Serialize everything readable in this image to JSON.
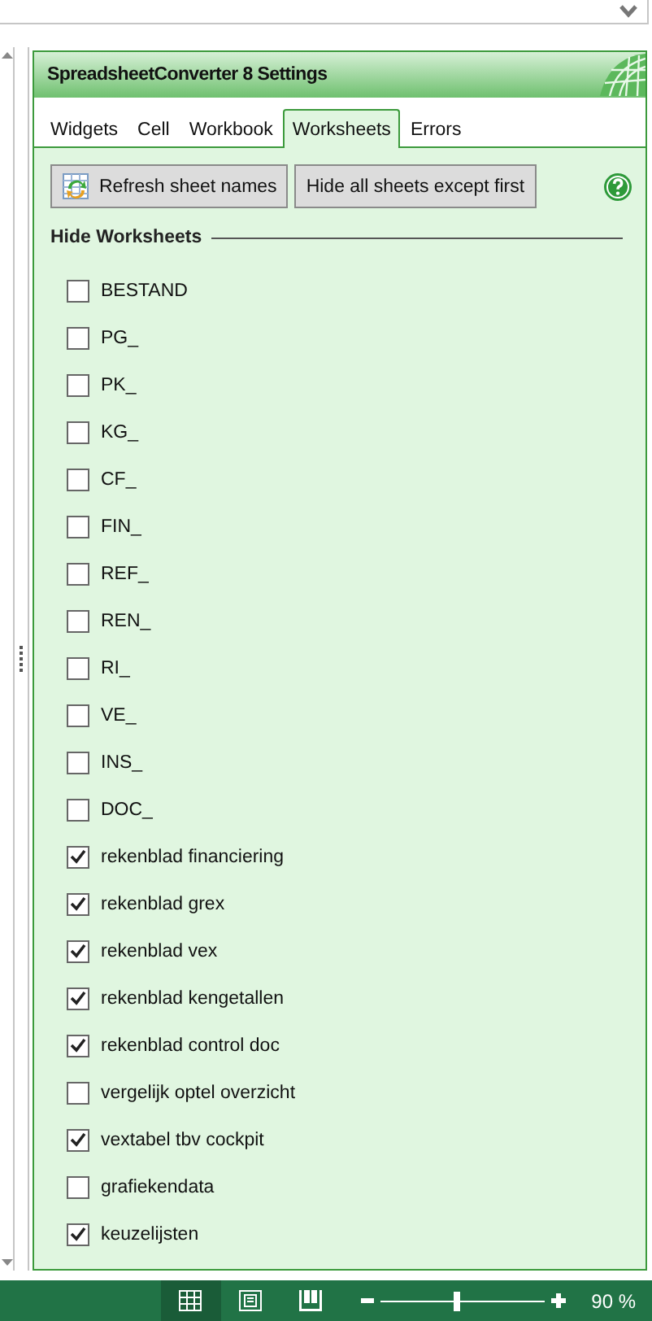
{
  "panel": {
    "title": "SpreadsheetConverter 8 Settings"
  },
  "tabs": [
    {
      "label": "Widgets",
      "selected": false
    },
    {
      "label": "Cell",
      "selected": false
    },
    {
      "label": "Workbook",
      "selected": false
    },
    {
      "label": "Worksheets",
      "selected": true
    },
    {
      "label": "Errors",
      "selected": false
    }
  ],
  "buttons": [
    "Refresh sheet names",
    "Hide all sheets except first"
  ],
  "section": {
    "title": "Hide Worksheets"
  },
  "worksheets": [
    {
      "label": "BESTAND",
      "checked": false
    },
    {
      "label": "PG_",
      "checked": false
    },
    {
      "label": "PK_",
      "checked": false
    },
    {
      "label": "KG_",
      "checked": false
    },
    {
      "label": "CF_",
      "checked": false
    },
    {
      "label": "FIN_",
      "checked": false
    },
    {
      "label": "REF_",
      "checked": false
    },
    {
      "label": "REN_",
      "checked": false
    },
    {
      "label": "RI_",
      "checked": false
    },
    {
      "label": "VE_",
      "checked": false
    },
    {
      "label": "INS_",
      "checked": false
    },
    {
      "label": "DOC_",
      "checked": false
    },
    {
      "label": "rekenblad financiering",
      "checked": true
    },
    {
      "label": "rekenblad grex",
      "checked": true
    },
    {
      "label": "rekenblad vex",
      "checked": true
    },
    {
      "label": "rekenblad kengetallen",
      "checked": true
    },
    {
      "label": "rekenblad control doc",
      "checked": true
    },
    {
      "label": "vergelijk optel overzicht",
      "checked": false
    },
    {
      "label": "vextabel tbv cockpit",
      "checked": true
    },
    {
      "label": "grafiekendata",
      "checked": false
    },
    {
      "label": "keuzelijsten",
      "checked": true
    }
  ],
  "status_bar": {
    "views": [
      {
        "kind": "normal",
        "selected": true
      },
      {
        "kind": "page_layout",
        "selected": false
      },
      {
        "kind": "page_break",
        "selected": false
      }
    ],
    "zoom": {
      "level": 0.47,
      "reading": "90 %"
    }
  }
}
